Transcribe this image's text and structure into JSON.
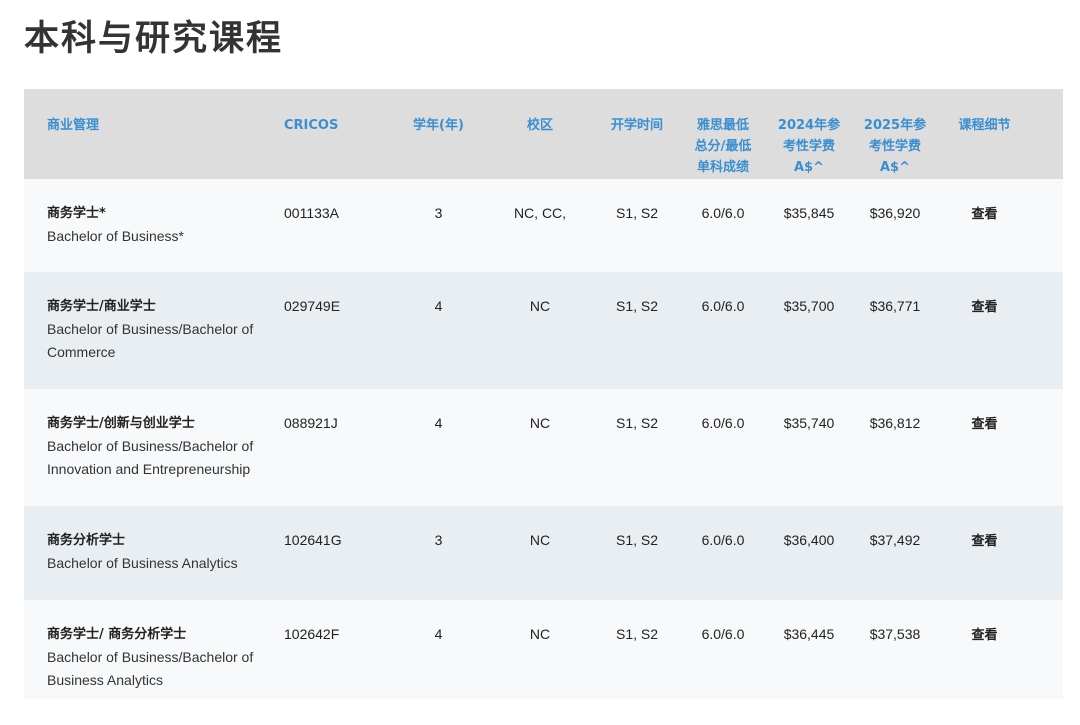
{
  "page": {
    "title": "本科与研究课程"
  },
  "table": {
    "headers": {
      "name": "商业管理",
      "cricos": "CRICOS",
      "years": "学年(年)",
      "campus": "校区",
      "intake": "开学时间",
      "ielts_l1": "雅思最低",
      "ielts_l2": "总分/最低",
      "ielts_l3": "单科成绩",
      "fee2024_l1": "2024年参",
      "fee2024_l2": "考性学费",
      "fee2024_l3": "A$^",
      "fee2025_l1": "2025年参",
      "fee2025_l2": "考性学费",
      "fee2025_l3": "A$^",
      "details": "课程细节"
    },
    "rows": [
      {
        "cn": "商务学士*",
        "en": "Bachelor of Business*",
        "cricos": "001133A",
        "years": "3",
        "campus": "NC, CC,",
        "intake": "S1, S2",
        "ielts": "6.0/6.0",
        "fee2024": "$35,845",
        "fee2025": "$36,920",
        "view": "查看"
      },
      {
        "cn": "商务学士/商业学士",
        "en": "Bachelor of Business/Bachelor of Commerce",
        "cricos": "029749E",
        "years": "4",
        "campus": "NC",
        "intake": "S1, S2",
        "ielts": "6.0/6.0",
        "fee2024": "$35,700",
        "fee2025": "$36,771",
        "view": "查看"
      },
      {
        "cn": "商务学士/创新与创业学士",
        "en": "Bachelor of Business/Bachelor of Innovation and Entrepreneurship",
        "cricos": "088921J",
        "years": "4",
        "campus": "NC",
        "intake": "S1, S2",
        "ielts": "6.0/6.0",
        "fee2024": "$35,740",
        "fee2025": "$36,812",
        "view": "查看"
      },
      {
        "cn": "商务分析学士",
        "en": "Bachelor of Business Analytics",
        "cricos": "102641G",
        "years": "3",
        "campus": "NC",
        "intake": "S1, S2",
        "ielts": "6.0/6.0",
        "fee2024": "$36,400",
        "fee2025": "$37,492",
        "view": "查看"
      },
      {
        "cn": "商务学士/ 商务分析学士",
        "en": "Bachelor of Business/Bachelor of Business Analytics",
        "cricos": "102642F",
        "years": "4",
        "campus": "NC",
        "intake": "S1, S2",
        "ielts": "6.0/6.0",
        "fee2024": "$36,445",
        "fee2025": "$37,538",
        "view": "查看"
      }
    ]
  }
}
